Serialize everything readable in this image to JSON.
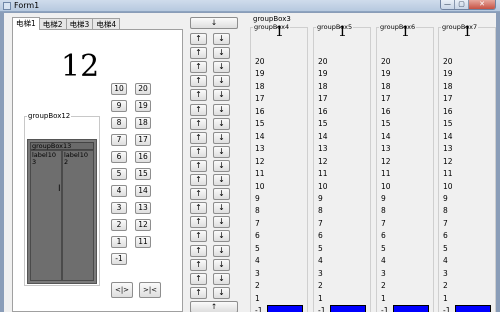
{
  "window": {
    "title": "Form1",
    "minimize": "—",
    "maximize": "▢",
    "close": "✕"
  },
  "tabs": [
    "电梯1",
    "电梯2",
    "电梯3",
    "电梯4"
  ],
  "elevator1": {
    "counter": "12",
    "floor_buttons_left": [
      "10",
      "9",
      "8",
      "7",
      "6",
      "5",
      "4",
      "3",
      "2",
      "1",
      "-1"
    ],
    "floor_buttons_right": [
      "20",
      "19",
      "18",
      "17",
      "16",
      "15",
      "14",
      "13",
      "12",
      "11"
    ],
    "groupbox_label": "groupBox12",
    "inner_groupbox_label": "groupBox13",
    "door_left_text": "label10\n3",
    "door_right_text": "label10\n2",
    "open_button": "<|>",
    "close_button": ">|<"
  },
  "arrows": {
    "top_down": "↓",
    "bottom_up": "↑",
    "up": "↑",
    "down": "↓"
  },
  "groupbox3": {
    "label": "groupBox3"
  },
  "panels": [
    {
      "title": "groupBox4",
      "number": "1",
      "floors": [
        "20",
        "19",
        "18",
        "17",
        "16",
        "15",
        "14",
        "13",
        "12",
        "11",
        "10",
        "9",
        "8",
        "7",
        "6",
        "5",
        "4",
        "3",
        "2",
        "1",
        "-1"
      ]
    },
    {
      "title": "groupBox5",
      "number": "1",
      "floors": [
        "20",
        "19",
        "18",
        "17",
        "16",
        "15",
        "14",
        "13",
        "12",
        "11",
        "10",
        "9",
        "8",
        "7",
        "6",
        "5",
        "4",
        "3",
        "2",
        "1",
        "-1"
      ]
    },
    {
      "title": "groupBox6",
      "number": "1",
      "floors": [
        "20",
        "19",
        "18",
        "17",
        "16",
        "15",
        "14",
        "13",
        "12",
        "11",
        "10",
        "9",
        "8",
        "7",
        "6",
        "5",
        "4",
        "3",
        "2",
        "1",
        "-1"
      ]
    },
    {
      "title": "groupBox7",
      "number": "1",
      "floors": [
        "20",
        "19",
        "18",
        "17",
        "16",
        "15",
        "14",
        "13",
        "12",
        "11",
        "10",
        "9",
        "8",
        "7",
        "6",
        "5",
        "4",
        "3",
        "2",
        "1",
        "-1"
      ]
    }
  ],
  "colors": {
    "indicator": "#0000ff",
    "window_frame": "#8a9db8"
  }
}
